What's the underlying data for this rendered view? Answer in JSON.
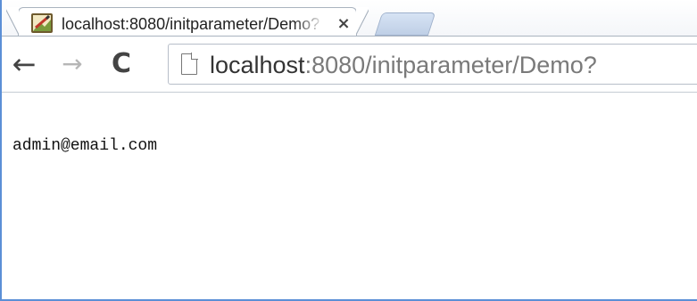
{
  "tab": {
    "title": "localhost:8080/initparameter/Demo?",
    "close_label": "×",
    "favicon": "pencil-image-icon"
  },
  "toolbar": {
    "back_icon": "back-arrow-icon",
    "forward_icon": "forward-arrow-icon",
    "reload_icon": "reload-icon",
    "back_glyph": "←",
    "forward_glyph": "→",
    "reload_glyph": "C"
  },
  "address_bar": {
    "host": "localhost",
    "rest": ":8080/initparameter/Demo?",
    "page_icon": "page-icon"
  },
  "page": {
    "text": "admin@email.com"
  },
  "colors": {
    "frame_border": "#5b8fd6",
    "new_tab": "#c9d8ee"
  }
}
